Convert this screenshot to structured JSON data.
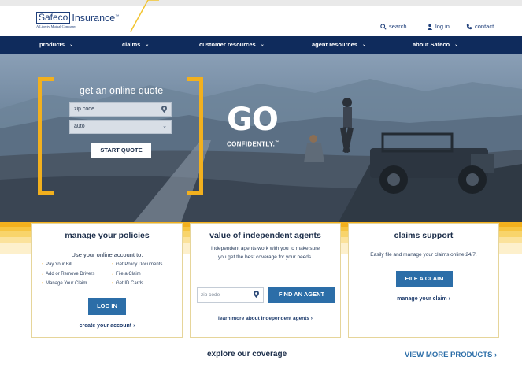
{
  "brand": {
    "logo_box": "Safeco",
    "logo_rest": "Insurance",
    "logo_tm": "™",
    "logo_sub": "A Liberty Mutual Company"
  },
  "utility": {
    "search": "search",
    "login": "log in",
    "contact": "contact"
  },
  "nav": {
    "items": [
      {
        "label": "products"
      },
      {
        "label": "claims"
      },
      {
        "label": "customer resources"
      },
      {
        "label": "agent resources"
      },
      {
        "label": "about Safeco"
      }
    ]
  },
  "hero": {
    "quote_title": "get an online quote",
    "zip_placeholder": "zip code",
    "product_value": "auto",
    "start_button": "START QUOTE",
    "go_text": "GO",
    "go_sub": "CONFIDENTLY.",
    "go_tm": "™"
  },
  "policies": {
    "title": "manage your policies",
    "subtitle": "Use your online account to:",
    "links_left": [
      "Pay Your Bill",
      "Add or Remove Drivers",
      "Manage Your Claim"
    ],
    "links_right": [
      "Get Policy Documents",
      "File a Claim",
      "Get ID Cards"
    ],
    "login_button": "LOG IN",
    "create_account": "create your account ›"
  },
  "agents": {
    "title": "value of independent agents",
    "description_line1": "Independent agents work with you to make sure",
    "description_line2": "you get the best coverage for your needs.",
    "zip_placeholder": "zip code",
    "find_button": "FIND AN AGENT",
    "learn_more": "learn more about independent agents ›"
  },
  "claims": {
    "title": "claims support",
    "description": "Easily file and manage your claims online 24/7.",
    "file_button": "FILE A CLAIM",
    "manage_link": "manage your claim ›"
  },
  "coverage": {
    "title": "explore our coverage",
    "view_more": "VIEW MORE PRODUCTS ›"
  },
  "colors": {
    "navy": "#0f2b5c",
    "accent_yellow": "#f2b01e",
    "button_blue": "#2c6ea8"
  }
}
